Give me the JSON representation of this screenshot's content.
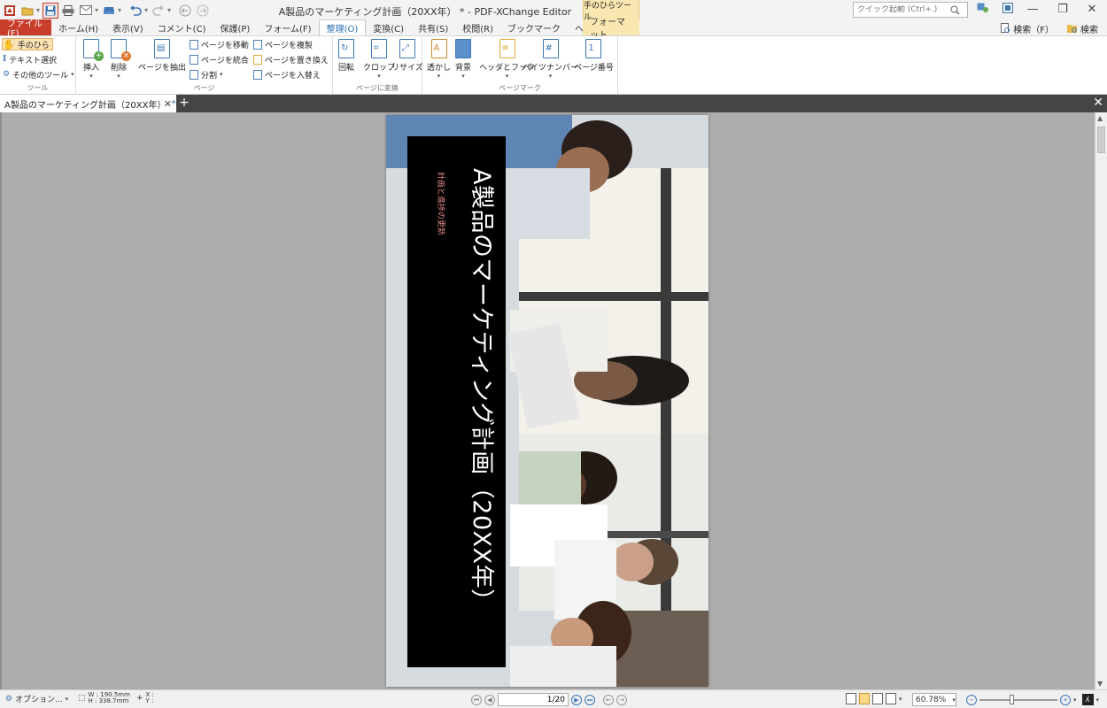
{
  "titlebar": {
    "title": "A製品のマーケティング計画（20XX年） * - PDF-XChange Editor",
    "context_tool": "手のひらツール",
    "quick_launch_placeholder": "クイック起動 (Ctrl+.)"
  },
  "menu": {
    "tabs": [
      "ファイル(F)",
      "ホーム(H)",
      "表示(V)",
      "コメント(C)",
      "保護(P)",
      "フォーム(F)",
      "整理(O)",
      "変換(C)",
      "共有(S)",
      "校閲(R)",
      "ブックマーク",
      "ヘルプ(H)"
    ],
    "selected": "整理(O)",
    "format_tab": "フォーマット",
    "search_find": "検索（F）",
    "search": "検索"
  },
  "ribbon": {
    "tools": {
      "label": "ツール",
      "hand": "手のひら",
      "select_text": "テキスト選択",
      "other_tools": "その他のツール"
    },
    "page": {
      "label": "ページ",
      "insert": "挿入",
      "delete": "削除",
      "extract": "ページを抽出",
      "move": "ページを移動",
      "merge": "ページを統合",
      "split": "分割",
      "duplicate": "ページを複製",
      "replace": "ページを置き換え",
      "swap": "ページを入替え"
    },
    "transform": {
      "label": "ページに変換",
      "rotate": "回転",
      "crop": "クロップ",
      "resize": "リサイズ"
    },
    "marks": {
      "label": "ページマーク",
      "watermark": "透かし",
      "background": "背景",
      "header_footer": "ヘッダとフッタ",
      "bates": "ベイツナンバー",
      "page_number": "ページ番号"
    }
  },
  "document_tab": {
    "label": "A製品のマーケティング計画（20XX年）",
    "modified_mark": "*"
  },
  "page_content": {
    "title": "A製品のマーケティング計画（20XX年）",
    "subtitle": "計画と進捗の更新"
  },
  "statusbar": {
    "options": "オプション...",
    "width": "W : 190.5mm",
    "height": "H : 338.7mm",
    "x": "X :",
    "y": "Y :",
    "page_indicator": "1/20",
    "zoom": "60.78%",
    "zoom_level": 0.4
  },
  "colors": {
    "file_tab": "#c83e2a",
    "accent_blue": "#2a6fb0",
    "context_tab": "#f9e6b0",
    "title_band": "#000000",
    "subtitle_color": "#e38b8b",
    "workspace": "#adadad"
  }
}
